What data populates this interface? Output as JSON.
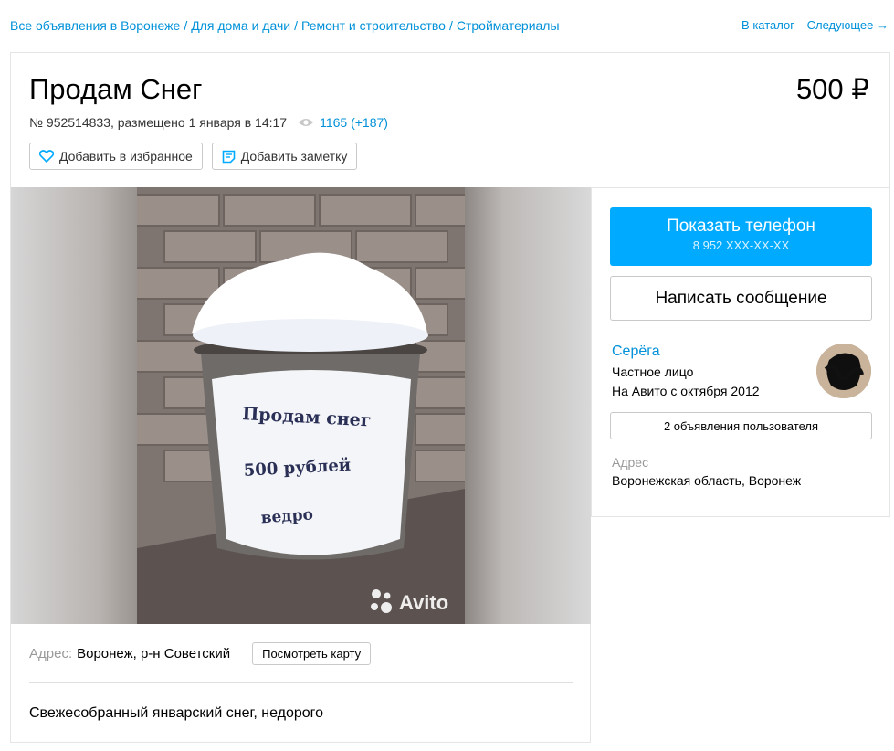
{
  "breadcrumb": {
    "items": [
      "Все объявления в Воронеже",
      "Для дома и дачи",
      "Ремонт и строительство",
      "Стройматериалы"
    ]
  },
  "topnav": {
    "catalog": "В каталог",
    "next": "Следующее →"
  },
  "listing": {
    "title": "Продам Снег",
    "price": "500 ₽",
    "meta": "№ 952514833, размещено 1 января в 14:17",
    "views": "1165 (+187)",
    "favorite_label": "Добавить в избранное",
    "note_label": "Добавить заметку",
    "watermark": "Avito",
    "bucket_text": [
      "Продам снег",
      "500 рублей",
      "ведро"
    ]
  },
  "location": {
    "label": "Адрес:",
    "value": "Воронеж, р-н Советский",
    "map_button": "Посмотреть карту"
  },
  "description": "Свежесобранный январский снег, недорого",
  "contact": {
    "phone_button": "Показать телефон",
    "phone_masked": "8 952 XXX-XX-XX",
    "message_button": "Написать сообщение"
  },
  "seller": {
    "name": "Серёга",
    "type": "Частное лицо",
    "since": "На Авито с октября 2012",
    "ads_button": "2 объявления пользователя",
    "address_label": "Адрес",
    "address_value": "Воронежская область, Воронеж"
  },
  "colors": {
    "link": "#0091d9",
    "phone_button": "#00aaff"
  }
}
